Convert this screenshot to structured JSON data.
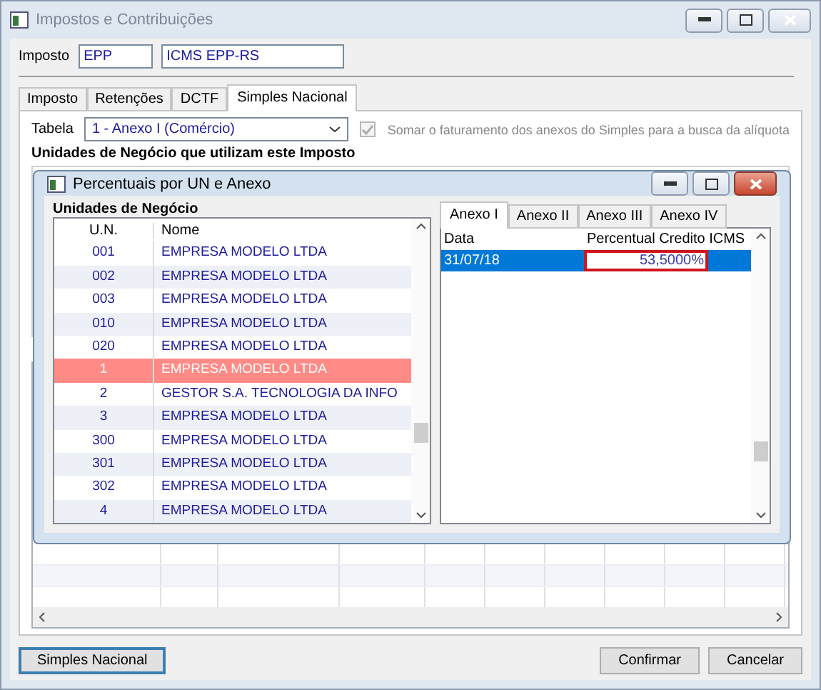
{
  "window": {
    "title": "Impostos e Contribuições"
  },
  "imposto": {
    "label": "Imposto",
    "code": "EPP",
    "description": "ICMS EPP-RS"
  },
  "tabs": [
    {
      "label": "Imposto",
      "selected": false
    },
    {
      "label": "Retenções",
      "selected": false
    },
    {
      "label": "DCTF",
      "selected": false
    },
    {
      "label": "Simples Nacional",
      "selected": true
    }
  ],
  "tabela": {
    "label": "Tabela",
    "value": "1 - Anexo I (Comércio)"
  },
  "somar": {
    "label": "Somar o faturamento dos anexos do Simples para a busca da alíquota",
    "checked": true
  },
  "units_group": {
    "title": "Unidades de Negócio que utilizam este Imposto"
  },
  "dialog": {
    "title": "Percentuais por UN e Anexo",
    "group_title": "Unidades de Negócio",
    "columns": [
      "U.N.",
      "Nome"
    ],
    "rows": [
      {
        "un": "001",
        "nome": "EMPRESA MODELO LTDA",
        "selected": false
      },
      {
        "un": "002",
        "nome": "EMPRESA MODELO LTDA",
        "selected": false
      },
      {
        "un": "003",
        "nome": "EMPRESA MODELO LTDA",
        "selected": false
      },
      {
        "un": "010",
        "nome": "EMPRESA MODELO LTDA",
        "selected": false
      },
      {
        "un": "020",
        "nome": "EMPRESA MODELO LTDA",
        "selected": false
      },
      {
        "un": "1",
        "nome": "EMPRESA MODELO LTDA",
        "selected": true
      },
      {
        "un": "2",
        "nome": "GESTOR S.A. TECNOLOGIA DA INFO",
        "selected": false
      },
      {
        "un": "3",
        "nome": "EMPRESA MODELO LTDA",
        "selected": false
      },
      {
        "un": "300",
        "nome": "EMPRESA MODELO LTDA",
        "selected": false
      },
      {
        "un": "301",
        "nome": "EMPRESA MODELO LTDA",
        "selected": false
      },
      {
        "un": "302",
        "nome": "EMPRESA MODELO LTDA",
        "selected": false
      },
      {
        "un": "4",
        "nome": "EMPRESA MODELO LTDA",
        "selected": false
      }
    ],
    "anexo_tabs": [
      {
        "label": "Anexo I",
        "selected": true
      },
      {
        "label": "Anexo II",
        "selected": false
      },
      {
        "label": "Anexo III",
        "selected": false
      },
      {
        "label": "Anexo IV",
        "selected": false
      }
    ],
    "credit_columns": [
      "Data",
      "Percentual Credito ICMS"
    ],
    "credit_rows": [
      {
        "data": "31/07/18",
        "percentual": "53,5000%",
        "selected": true
      }
    ]
  },
  "buttons": [
    {
      "label": "Simples Nacional",
      "focused": true
    },
    {
      "label": "Confirmar",
      "focused": false
    },
    {
      "label": "Cancelar",
      "focused": false
    }
  ]
}
